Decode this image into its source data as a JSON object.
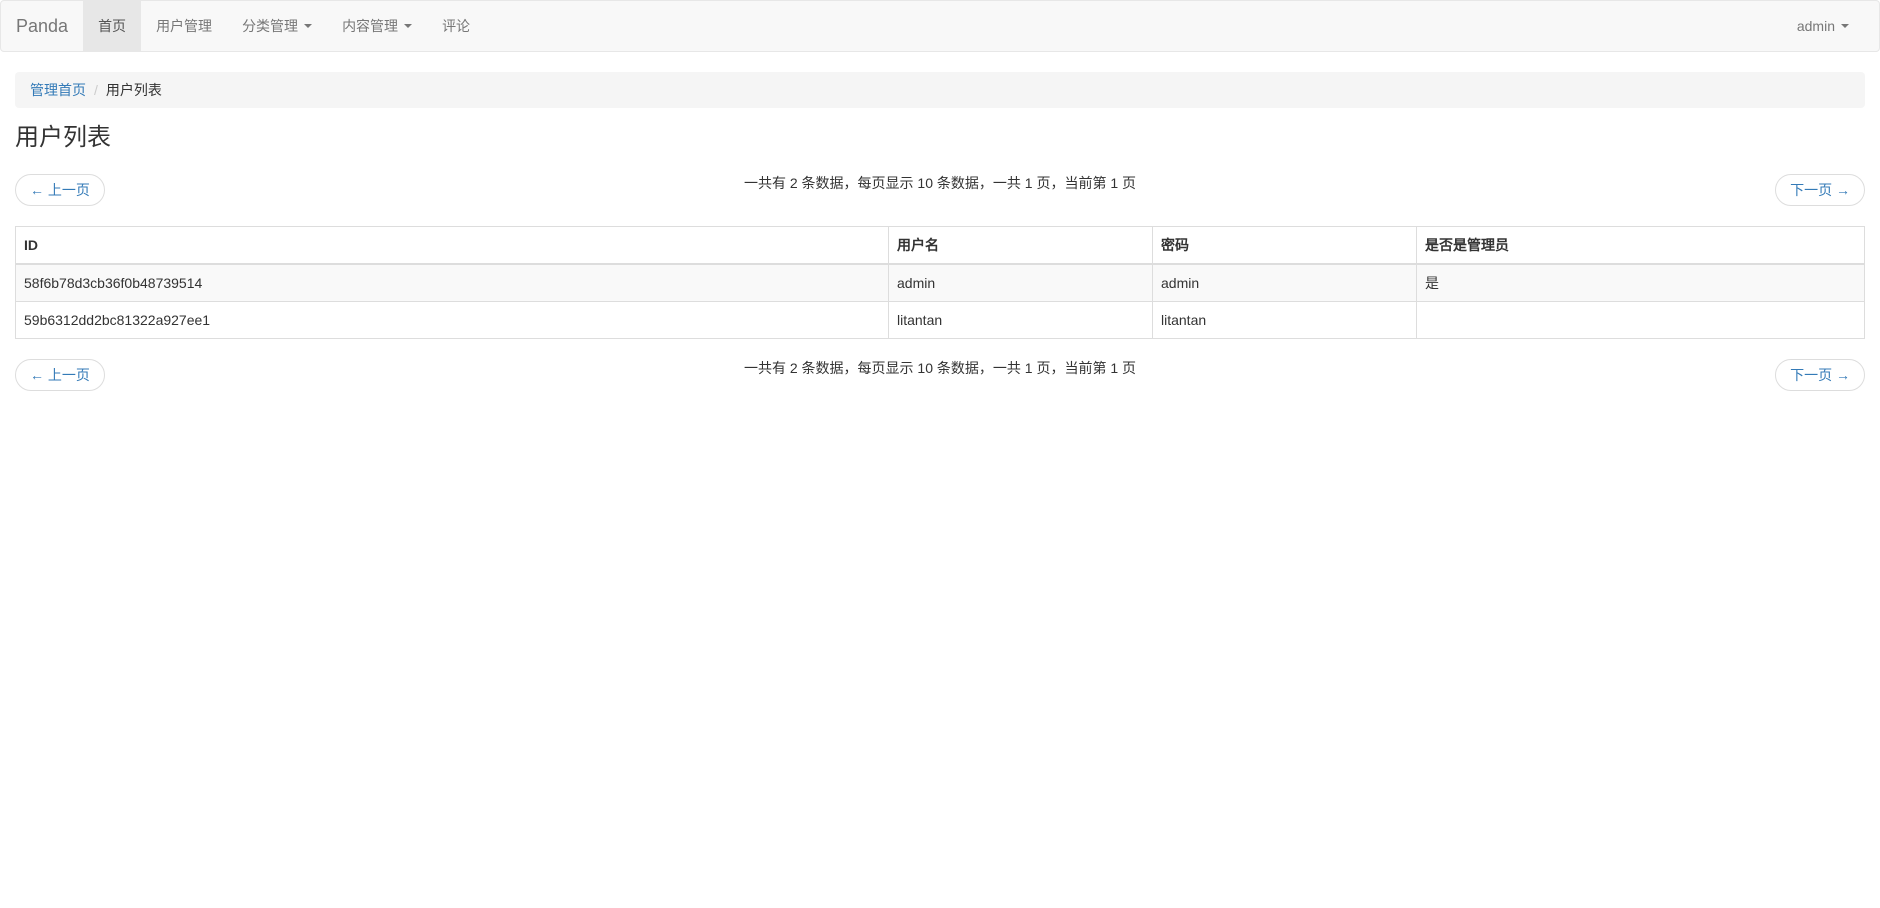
{
  "navbar": {
    "brand": "Panda",
    "items": [
      {
        "label": "首页",
        "active": true,
        "dropdown": false
      },
      {
        "label": "用户管理",
        "active": false,
        "dropdown": false
      },
      {
        "label": "分类管理",
        "active": false,
        "dropdown": true
      },
      {
        "label": "内容管理",
        "active": false,
        "dropdown": true
      },
      {
        "label": "评论",
        "active": false,
        "dropdown": false
      }
    ],
    "user": "admin"
  },
  "breadcrumb": {
    "home": "管理首页",
    "separator": "/",
    "current": "用户列表"
  },
  "page": {
    "title": "用户列表"
  },
  "pager": {
    "prev_label": "← 上一页",
    "next_label": "下一页 →",
    "info": "一共有 2 条数据，每页显示 10 条数据，一共 1 页，当前第 1 页"
  },
  "table": {
    "headers": [
      "ID",
      "用户名",
      "密码",
      "是否是管理员"
    ],
    "rows": [
      [
        "58f6b78d3cb36f0b48739514",
        "admin",
        "admin",
        "是"
      ],
      [
        "59b6312dd2bc81322a927ee1",
        "litantan",
        "litantan",
        ""
      ]
    ]
  },
  "colors": {
    "link": "#337ab7",
    "navbar_bg": "#f8f8f8",
    "nav_active_bg": "#e7e7e7",
    "breadcrumb_bg": "#f5f5f5"
  }
}
